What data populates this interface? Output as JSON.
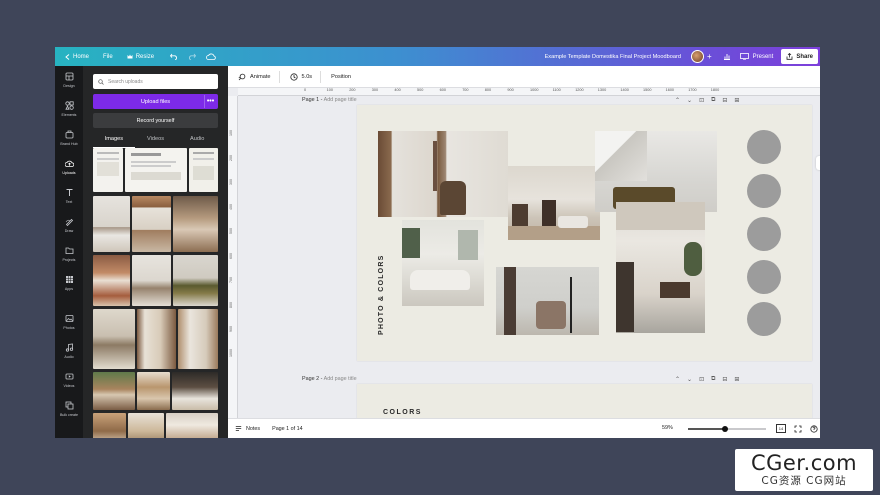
{
  "topbar": {
    "home_label": "Home",
    "file_label": "File",
    "resize_label": "Resize",
    "doc_title": "Example Template Domestika Final Project Moodboard",
    "plus": "+",
    "present_label": "Present",
    "share_label": "Share",
    "accent_color": "#7d2ae8"
  },
  "rail": [
    {
      "label": "Design",
      "icon": "design-icon"
    },
    {
      "label": "Elements",
      "icon": "elements-icon"
    },
    {
      "label": "Brand Hub",
      "icon": "brand-hub-icon"
    },
    {
      "label": "Uploads",
      "icon": "uploads-icon"
    },
    {
      "label": "Text",
      "icon": "text-icon"
    },
    {
      "label": "Draw",
      "icon": "draw-icon"
    },
    {
      "label": "Projects",
      "icon": "projects-icon"
    },
    {
      "label": "Apps",
      "icon": "apps-icon"
    },
    {
      "label": "Photos",
      "icon": "photos-icon"
    },
    {
      "label": "Audio",
      "icon": "audio-icon"
    },
    {
      "label": "Videos",
      "icon": "videos-icon"
    },
    {
      "label": "Bulk create",
      "icon": "bulk-create-icon"
    }
  ],
  "panel": {
    "search_placeholder": "Search uploads",
    "upload_label": "Upload files",
    "upload_more": "•••",
    "record_label": "Record yourself",
    "tabs": [
      "Images",
      "Videos",
      "Audio"
    ]
  },
  "toolbar": {
    "animate_label": "Animate",
    "duration_label": "5.0s",
    "position_label": "Position"
  },
  "ruler": {
    "top": [
      "0",
      "100",
      "200",
      "300",
      "400",
      "500",
      "600",
      "700",
      "800",
      "900",
      "1000",
      "1100",
      "1200",
      "1300",
      "1400",
      "1500",
      "1600",
      "1700",
      "1800"
    ],
    "left": [
      "100",
      "200",
      "300",
      "400",
      "500",
      "600",
      "700",
      "800",
      "900",
      "1000"
    ]
  },
  "pages": [
    {
      "label": "Page 1",
      "title_placeholder": "Add page title",
      "vertical_text": "PHOTO & COLORS"
    },
    {
      "label": "Page 2",
      "title_placeholder": "Add page title"
    }
  ],
  "page_sep": " - ",
  "page2_peek": "COLORS",
  "bottombar": {
    "notes_label": "Notes",
    "page_counter": "Page 1 of 14",
    "zoom_label": "59%",
    "zoom_fraction": 0.48,
    "page_badge": "14"
  },
  "watermark": {
    "main": "CGer.com",
    "sub": "CG资源 CG网站"
  }
}
